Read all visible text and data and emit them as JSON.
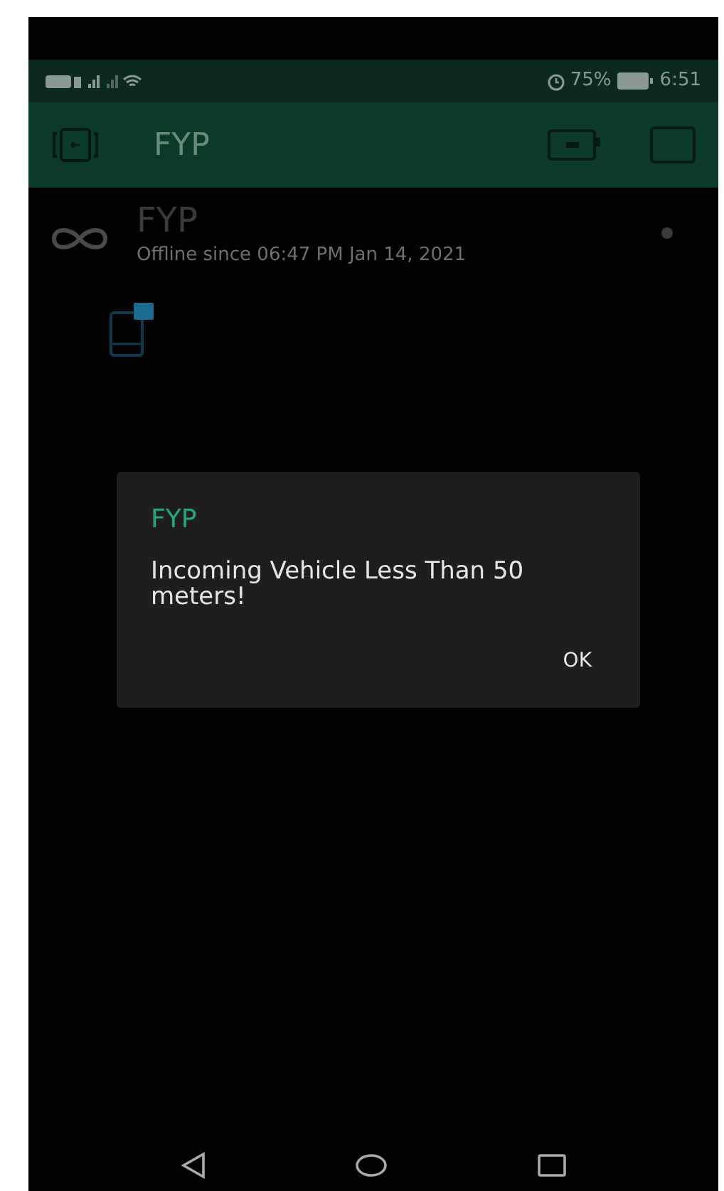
{
  "status_bar": {
    "battery_percent": "75%",
    "time": "6:51"
  },
  "app_bar": {
    "title": "FYP"
  },
  "device": {
    "name": "FYP",
    "status": "Offline since 06:47 PM Jan 14, 2021",
    "online": false
  },
  "dialog": {
    "title": "FYP",
    "message": "Incoming Vehicle Less Than 50 meters!",
    "buttons": [
      "OK"
    ]
  }
}
